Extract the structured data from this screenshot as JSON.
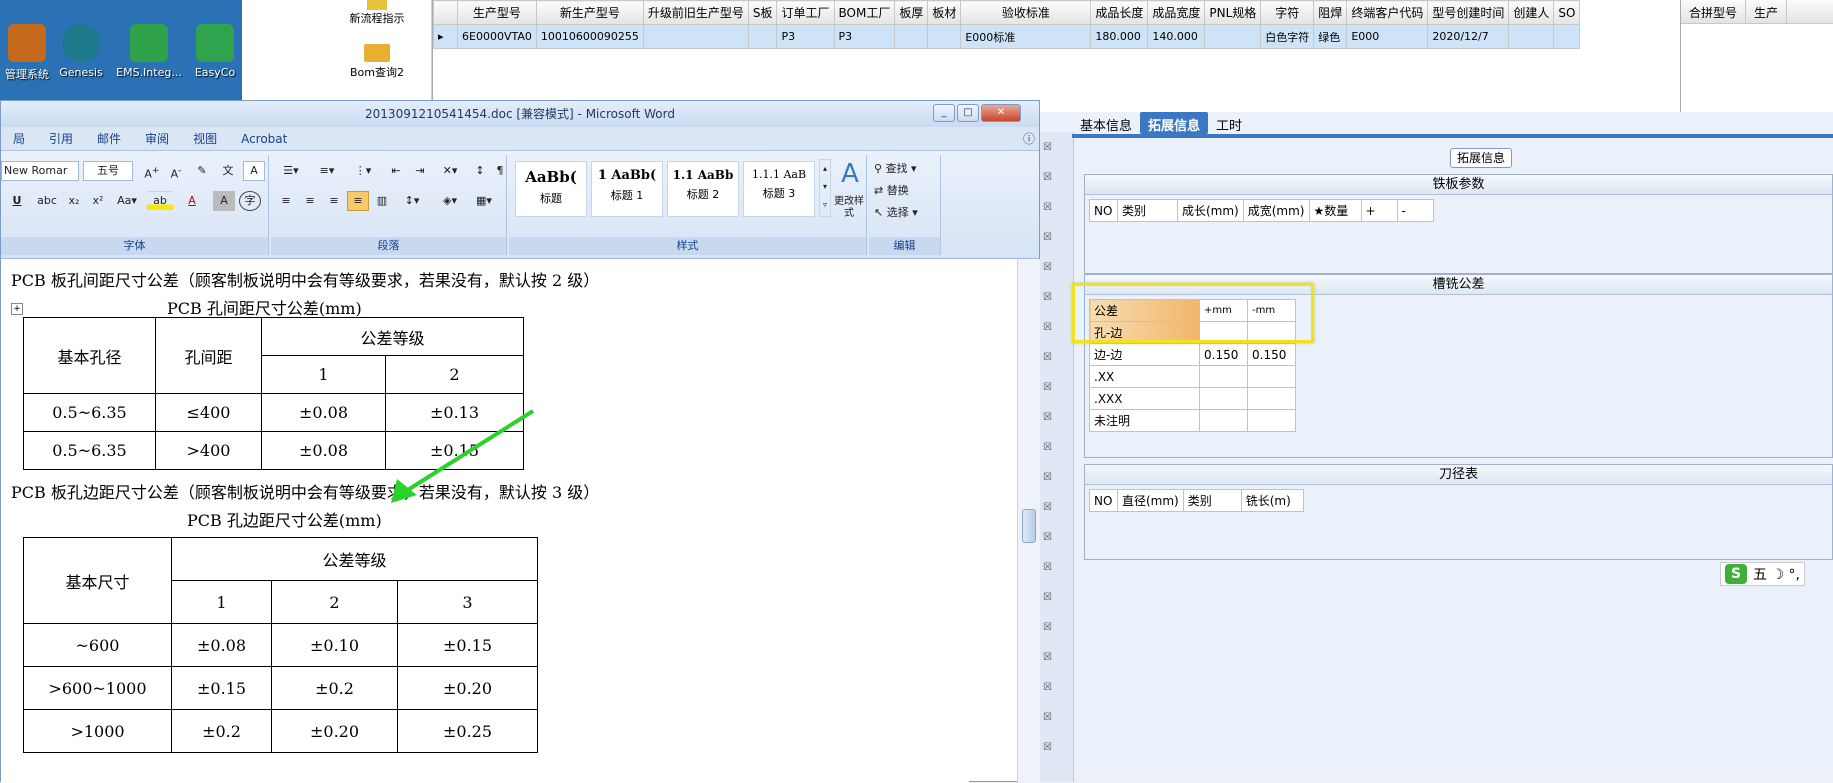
{
  "desktop": {
    "icons": [
      {
        "label": "管理系统",
        "color": "#c56a1c"
      },
      {
        "label": "Genesis",
        "color": "#1d7a8a"
      },
      {
        "label": "EMS.Integ...",
        "color": "#30a34a"
      },
      {
        "label": "EasyCo",
        "color": "#2fa34e"
      }
    ]
  },
  "bom": {
    "item1": "新流程指示",
    "item2": "Bom查询2"
  },
  "top_grid": {
    "headers": [
      "生产型号",
      "新生产型号",
      "升级前旧生产型号",
      "S板",
      "订单工厂",
      "BOM工厂",
      "板厚",
      "板材",
      "验收标准",
      "成品长度",
      "成品宽度",
      "PNL规格",
      "字符",
      "阻焊",
      "终端客户代码",
      "型号创建时间",
      "创建人",
      "SO"
    ],
    "row": [
      "6E0000VTA0",
      "10010600090255",
      "",
      "",
      "P3",
      "P3",
      "",
      "",
      "E000标准",
      "180.000",
      "140.000",
      "",
      "白色字符",
      "绿色",
      "E000",
      "2020/12/7",
      "",
      ""
    ]
  },
  "right_grid": {
    "h1": "合拼型号",
    "h2": "生产"
  },
  "word": {
    "title": "2013091210541454.doc [兼容模式] - Microsoft Word",
    "tabs": [
      "局",
      "引用",
      "邮件",
      "审阅",
      "视图",
      "Acrobat"
    ],
    "font_name": "New Romar",
    "font_size": "五号",
    "groups": {
      "font": "字体",
      "paragraph": "段落",
      "styles": "样式",
      "edit": "编辑"
    },
    "styles": [
      {
        "sample": "AaBb(",
        "name": "标题"
      },
      {
        "sample": "1 AaBb(",
        "name": "标题 1"
      },
      {
        "sample": "1.1 AaBb",
        "name": "标题 2"
      },
      {
        "sample": "1.1.1 AaB",
        "name": "标题 3"
      }
    ],
    "change_styles": "更改样式",
    "find": "查找",
    "replace": "替换",
    "select": "选择"
  },
  "doc": {
    "para1": "PCB 板孔间距尺寸公差（顾客制板说明中会有等级要求，若果没有，默认按 2 级）",
    "cap1": "PCB 孔间距尺寸公差(mm)",
    "t1": {
      "h_base": "基本孔径",
      "h_spacing": "孔间距",
      "h_grade": "公差等级",
      "g1": "1",
      "g2": "2",
      "rows": [
        {
          "base": "0.5~6.35",
          "spacing": "≤400",
          "v1": "±0.08",
          "v2": "±0.13"
        },
        {
          "base": "0.5~6.35",
          "spacing": ">400",
          "v1": "±0.08",
          "v2": "±0.15"
        }
      ]
    },
    "para2": "PCB 板孔边距尺寸公差（顾客制板说明中会有等级要求，若果没有，默认按 3 级）",
    "cap2": "PCB 孔边距尺寸公差(mm)",
    "t2": {
      "h_base": "基本尺寸",
      "h_grade": "公差等级",
      "g1": "1",
      "g2": "2",
      "g3": "3",
      "rows": [
        {
          "base": "~600",
          "v1": "±0.08",
          "v2": "±0.10",
          "v3": "±0.15"
        },
        {
          "base": ">600~1000",
          "v1": "±0.15",
          "v2": "±0.2",
          "v3": "±0.20"
        },
        {
          "base": ">1000",
          "v1": "±0.2",
          "v2": "±0.20",
          "v3": "±0.25"
        }
      ]
    }
  },
  "panel": {
    "tabs": [
      "基本信息",
      "拓展信息",
      "工时"
    ],
    "ext_title": "拓展信息",
    "steel": {
      "title": "铁板参数",
      "cols": [
        "NO",
        "类别",
        "成长(mm)",
        "成宽(mm)",
        "★数量",
        "+",
        "-"
      ]
    },
    "groove": {
      "title": "槽铣公差",
      "h0": "公差",
      "h1": "+mm",
      "h2": "-mm",
      "rows": [
        {
          "name": "孔-边",
          "p": "",
          "m": ""
        },
        {
          "name": "边-边",
          "p": "0.150",
          "m": "0.150"
        },
        {
          "name": ".XX",
          "p": "",
          "m": ""
        },
        {
          "name": ".XXX",
          "p": "",
          "m": ""
        },
        {
          "name": "未注明",
          "p": "",
          "m": ""
        }
      ]
    },
    "tool": {
      "title": "刀径表",
      "cols": [
        "NO",
        "直径(mm)",
        "类别",
        "铣长(m)"
      ]
    }
  },
  "ime": {
    "text": "五 ☽ °,",
    "logo": "S"
  },
  "colors": {
    "highlight": "#f2e21d",
    "arrow": "#2ad22a",
    "tab_active": "#3a78c4"
  }
}
